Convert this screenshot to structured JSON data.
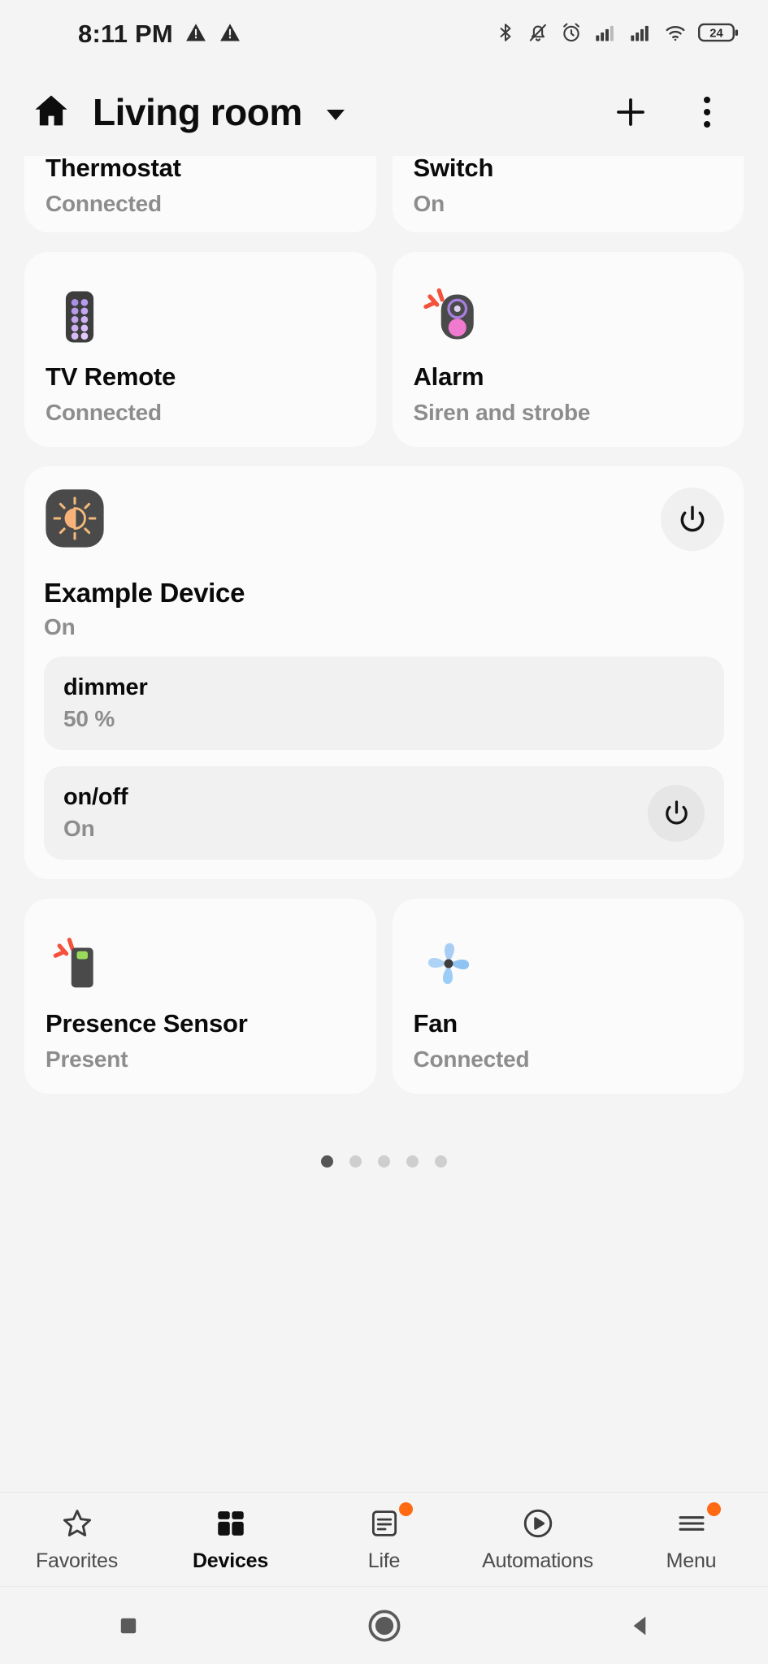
{
  "status_bar": {
    "time": "8:11 PM",
    "left_icons": [
      "warning-triangle-icon",
      "warning-triangle-icon"
    ],
    "right_icons": [
      "bluetooth-icon",
      "notifications-muted-icon",
      "alarm-clock-icon",
      "signal-bars-icon",
      "signal-bars-icon",
      "wifi-icon"
    ],
    "battery_level": "24"
  },
  "header": {
    "home_icon": "home-icon",
    "title": "Living room",
    "dropdown_icon": "chevron-down-icon",
    "add_icon": "plus-icon",
    "overflow_icon": "more-vertical-icon"
  },
  "device_rows": [
    {
      "clipped": true,
      "cards": [
        {
          "name": "Thermostat",
          "status": "Connected",
          "icon": "thermostat-icon"
        },
        {
          "name": "Switch",
          "status": "On",
          "icon": "switch-icon"
        }
      ]
    },
    {
      "clipped": false,
      "cards": [
        {
          "name": "TV Remote",
          "status": "Connected",
          "icon": "tv-remote-icon"
        },
        {
          "name": "Alarm",
          "status": "Siren and strobe",
          "icon": "alarm-siren-icon"
        }
      ]
    }
  ],
  "featured_device": {
    "icon": "brightness-dimmer-icon",
    "name": "Example Device",
    "status": "On",
    "power_button_icon": "power-icon",
    "capabilities": [
      {
        "name": "dimmer",
        "value": "50 %",
        "has_toggle": false
      },
      {
        "name": "on/off",
        "value": "On",
        "has_toggle": true,
        "toggle_icon": "power-icon"
      }
    ]
  },
  "bottom_device_row": {
    "cards": [
      {
        "name": "Presence Sensor",
        "status": "Present",
        "icon": "presence-sensor-icon"
      },
      {
        "name": "Fan",
        "status": "Connected",
        "icon": "fan-pinwheel-icon"
      }
    ]
  },
  "pagination": {
    "total": 5,
    "active_index": 0
  },
  "bottom_nav": {
    "items": [
      {
        "label": "Favorites",
        "icon": "star-icon",
        "active": false,
        "badge": false
      },
      {
        "label": "Devices",
        "icon": "devices-grid-icon",
        "active": true,
        "badge": false
      },
      {
        "label": "Life",
        "icon": "life-card-icon",
        "active": false,
        "badge": true
      },
      {
        "label": "Automations",
        "icon": "play-circle-icon",
        "active": false,
        "badge": false
      },
      {
        "label": "Menu",
        "icon": "hamburger-menu-icon",
        "active": false,
        "badge": true
      }
    ]
  },
  "system_nav": {
    "recents_icon": "square-icon",
    "home_icon": "circle-icon",
    "back_icon": "triangle-back-icon"
  },
  "colors": {
    "accent_badge": "#ff6a13",
    "card_bg": "#fbfbfb",
    "page_bg": "#f4f4f4",
    "muted_text": "#8d8d8d",
    "primary_text": "#0a0a0a"
  }
}
